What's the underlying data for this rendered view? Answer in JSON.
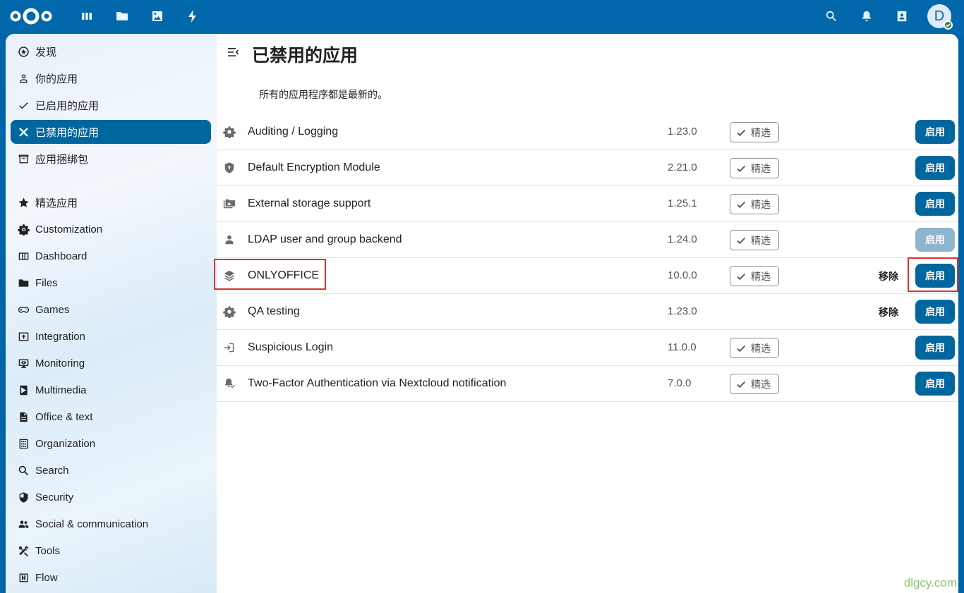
{
  "header": {
    "logo": "nextcloud-logo",
    "apps": [
      {
        "name": "dashboard-icon"
      },
      {
        "name": "files-icon"
      },
      {
        "name": "photos-icon"
      },
      {
        "name": "activity-icon"
      }
    ],
    "avatar_letter": "D"
  },
  "sidebar": {
    "primary": [
      {
        "label": "发现",
        "icon": "star-circle-icon"
      },
      {
        "label": "你的应用",
        "icon": "account-icon"
      },
      {
        "label": "已启用的应用",
        "icon": "check-icon"
      },
      {
        "label": "已禁用的应用",
        "icon": "close-icon",
        "active": true
      },
      {
        "label": "应用捆绑包",
        "icon": "archive-icon"
      }
    ],
    "categories": [
      {
        "label": "精选应用",
        "icon": "star-icon"
      },
      {
        "label": "Customization",
        "icon": "cog-icon"
      },
      {
        "label": "Dashboard",
        "icon": "view-column-icon"
      },
      {
        "label": "Files",
        "icon": "folder-icon"
      },
      {
        "label": "Games",
        "icon": "gamepad-icon"
      },
      {
        "label": "Integration",
        "icon": "integration-icon"
      },
      {
        "label": "Monitoring",
        "icon": "monitor-eye-icon"
      },
      {
        "label": "Multimedia",
        "icon": "multimedia-icon"
      },
      {
        "label": "Office & text",
        "icon": "file-document-icon"
      },
      {
        "label": "Organization",
        "icon": "office-building-icon"
      },
      {
        "label": "Search",
        "icon": "magnify-icon"
      },
      {
        "label": "Security",
        "icon": "shield-icon"
      },
      {
        "label": "Social & communication",
        "icon": "account-group-icon"
      },
      {
        "label": "Tools",
        "icon": "tools-icon"
      },
      {
        "label": "Flow",
        "icon": "flow-icon"
      }
    ]
  },
  "main": {
    "title": "已禁用的应用",
    "status": "所有的应用程序都是最新的。",
    "featured_label": "精选",
    "remove_label": "移除",
    "enable_label": "启用",
    "apps": [
      {
        "name": "Auditing / Logging",
        "version": "1.23.0",
        "icon": "cog-icon",
        "featured": true,
        "remove": false,
        "enable_disabled": false
      },
      {
        "name": "Default Encryption Module",
        "version": "2.21.0",
        "icon": "shield-icon",
        "featured": true,
        "remove": false,
        "enable_disabled": false
      },
      {
        "name": "External storage support",
        "version": "1.25.1",
        "icon": "folder-multiple-icon",
        "featured": true,
        "remove": false,
        "enable_disabled": false
      },
      {
        "name": "LDAP user and group backend",
        "version": "1.24.0",
        "icon": "account-icon",
        "featured": true,
        "remove": false,
        "enable_disabled": true
      },
      {
        "name": "ONLYOFFICE",
        "version": "10.0.0",
        "icon": "layers-icon",
        "featured": true,
        "remove": true,
        "enable_disabled": false
      },
      {
        "name": "QA testing",
        "version": "1.23.0",
        "icon": "cog-icon",
        "featured": false,
        "remove": true,
        "enable_disabled": false
      },
      {
        "name": "Suspicious Login",
        "version": "11.0.0",
        "icon": "login-icon",
        "featured": true,
        "remove": false,
        "enable_disabled": false
      },
      {
        "name": "Two-Factor Authentication via Nextcloud notification",
        "version": "7.0.0",
        "icon": "bell-check-icon",
        "featured": true,
        "remove": false,
        "enable_disabled": false
      }
    ]
  },
  "watermark": "dlgcy.com"
}
